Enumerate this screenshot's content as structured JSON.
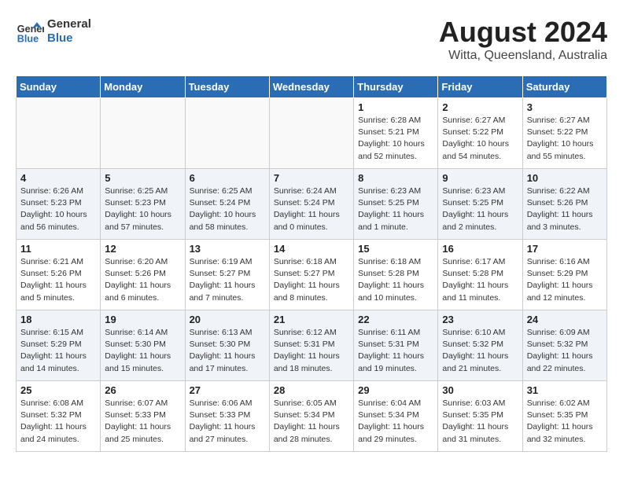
{
  "logo": {
    "line1": "General",
    "line2": "Blue"
  },
  "title": {
    "month_year": "August 2024",
    "location": "Witta, Queensland, Australia"
  },
  "days_of_week": [
    "Sunday",
    "Monday",
    "Tuesday",
    "Wednesday",
    "Thursday",
    "Friday",
    "Saturday"
  ],
  "weeks": [
    [
      {
        "day": "",
        "info": ""
      },
      {
        "day": "",
        "info": ""
      },
      {
        "day": "",
        "info": ""
      },
      {
        "day": "",
        "info": ""
      },
      {
        "day": "1",
        "info": "Sunrise: 6:28 AM\nSunset: 5:21 PM\nDaylight: 10 hours\nand 52 minutes."
      },
      {
        "day": "2",
        "info": "Sunrise: 6:27 AM\nSunset: 5:22 PM\nDaylight: 10 hours\nand 54 minutes."
      },
      {
        "day": "3",
        "info": "Sunrise: 6:27 AM\nSunset: 5:22 PM\nDaylight: 10 hours\nand 55 minutes."
      }
    ],
    [
      {
        "day": "4",
        "info": "Sunrise: 6:26 AM\nSunset: 5:23 PM\nDaylight: 10 hours\nand 56 minutes."
      },
      {
        "day": "5",
        "info": "Sunrise: 6:25 AM\nSunset: 5:23 PM\nDaylight: 10 hours\nand 57 minutes."
      },
      {
        "day": "6",
        "info": "Sunrise: 6:25 AM\nSunset: 5:24 PM\nDaylight: 10 hours\nand 58 minutes."
      },
      {
        "day": "7",
        "info": "Sunrise: 6:24 AM\nSunset: 5:24 PM\nDaylight: 11 hours\nand 0 minutes."
      },
      {
        "day": "8",
        "info": "Sunrise: 6:23 AM\nSunset: 5:25 PM\nDaylight: 11 hours\nand 1 minute."
      },
      {
        "day": "9",
        "info": "Sunrise: 6:23 AM\nSunset: 5:25 PM\nDaylight: 11 hours\nand 2 minutes."
      },
      {
        "day": "10",
        "info": "Sunrise: 6:22 AM\nSunset: 5:26 PM\nDaylight: 11 hours\nand 3 minutes."
      }
    ],
    [
      {
        "day": "11",
        "info": "Sunrise: 6:21 AM\nSunset: 5:26 PM\nDaylight: 11 hours\nand 5 minutes."
      },
      {
        "day": "12",
        "info": "Sunrise: 6:20 AM\nSunset: 5:26 PM\nDaylight: 11 hours\nand 6 minutes."
      },
      {
        "day": "13",
        "info": "Sunrise: 6:19 AM\nSunset: 5:27 PM\nDaylight: 11 hours\nand 7 minutes."
      },
      {
        "day": "14",
        "info": "Sunrise: 6:18 AM\nSunset: 5:27 PM\nDaylight: 11 hours\nand 8 minutes."
      },
      {
        "day": "15",
        "info": "Sunrise: 6:18 AM\nSunset: 5:28 PM\nDaylight: 11 hours\nand 10 minutes."
      },
      {
        "day": "16",
        "info": "Sunrise: 6:17 AM\nSunset: 5:28 PM\nDaylight: 11 hours\nand 11 minutes."
      },
      {
        "day": "17",
        "info": "Sunrise: 6:16 AM\nSunset: 5:29 PM\nDaylight: 11 hours\nand 12 minutes."
      }
    ],
    [
      {
        "day": "18",
        "info": "Sunrise: 6:15 AM\nSunset: 5:29 PM\nDaylight: 11 hours\nand 14 minutes."
      },
      {
        "day": "19",
        "info": "Sunrise: 6:14 AM\nSunset: 5:30 PM\nDaylight: 11 hours\nand 15 minutes."
      },
      {
        "day": "20",
        "info": "Sunrise: 6:13 AM\nSunset: 5:30 PM\nDaylight: 11 hours\nand 17 minutes."
      },
      {
        "day": "21",
        "info": "Sunrise: 6:12 AM\nSunset: 5:31 PM\nDaylight: 11 hours\nand 18 minutes."
      },
      {
        "day": "22",
        "info": "Sunrise: 6:11 AM\nSunset: 5:31 PM\nDaylight: 11 hours\nand 19 minutes."
      },
      {
        "day": "23",
        "info": "Sunrise: 6:10 AM\nSunset: 5:32 PM\nDaylight: 11 hours\nand 21 minutes."
      },
      {
        "day": "24",
        "info": "Sunrise: 6:09 AM\nSunset: 5:32 PM\nDaylight: 11 hours\nand 22 minutes."
      }
    ],
    [
      {
        "day": "25",
        "info": "Sunrise: 6:08 AM\nSunset: 5:32 PM\nDaylight: 11 hours\nand 24 minutes."
      },
      {
        "day": "26",
        "info": "Sunrise: 6:07 AM\nSunset: 5:33 PM\nDaylight: 11 hours\nand 25 minutes."
      },
      {
        "day": "27",
        "info": "Sunrise: 6:06 AM\nSunset: 5:33 PM\nDaylight: 11 hours\nand 27 minutes."
      },
      {
        "day": "28",
        "info": "Sunrise: 6:05 AM\nSunset: 5:34 PM\nDaylight: 11 hours\nand 28 minutes."
      },
      {
        "day": "29",
        "info": "Sunrise: 6:04 AM\nSunset: 5:34 PM\nDaylight: 11 hours\nand 29 minutes."
      },
      {
        "day": "30",
        "info": "Sunrise: 6:03 AM\nSunset: 5:35 PM\nDaylight: 11 hours\nand 31 minutes."
      },
      {
        "day": "31",
        "info": "Sunrise: 6:02 AM\nSunset: 5:35 PM\nDaylight: 11 hours\nand 32 minutes."
      }
    ]
  ]
}
